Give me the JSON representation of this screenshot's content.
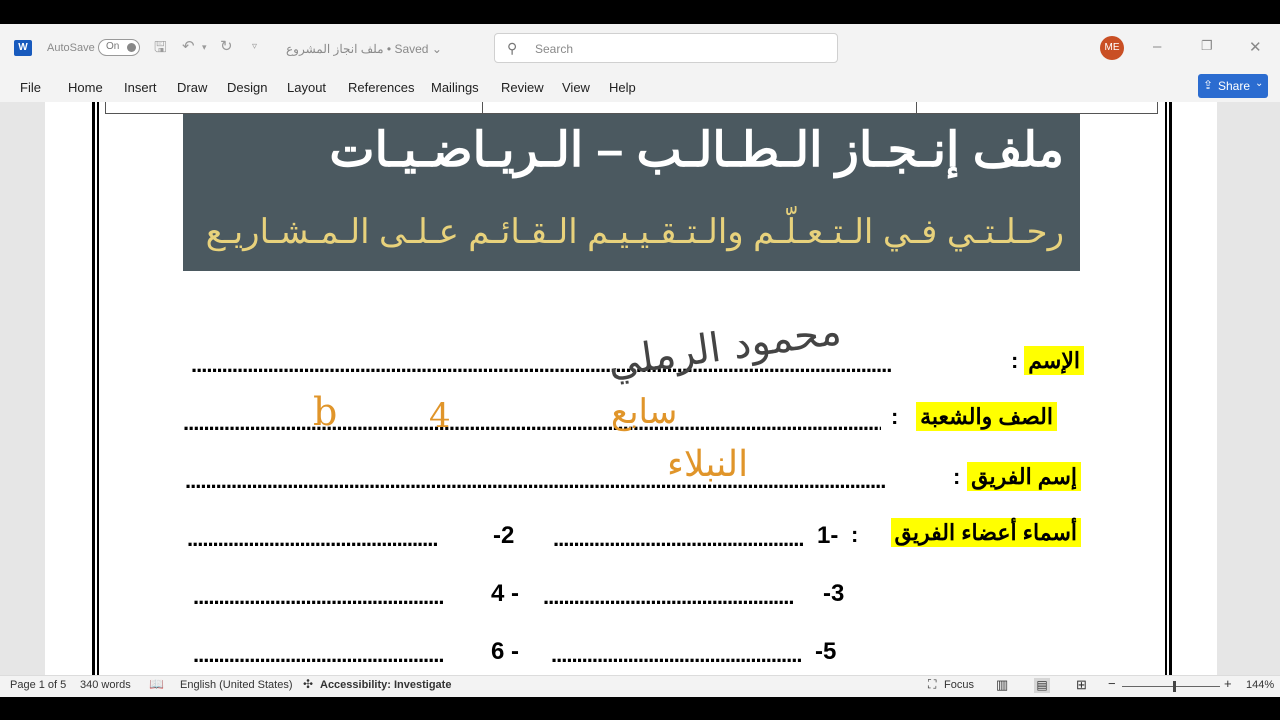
{
  "titlebar": {
    "autosave_label": "AutoSave",
    "autosave_state": "On",
    "doc_title": "ملف انجاز المشروع",
    "saved_status": "• Saved",
    "search_placeholder": "Search",
    "user_initials": "ME"
  },
  "menu": {
    "items": [
      "File",
      "Home",
      "Insert",
      "Draw",
      "Design",
      "Layout",
      "References",
      "Mailings",
      "Review",
      "View",
      "Help"
    ],
    "share_label": "Share"
  },
  "document": {
    "banner_title": "ملف إنـجـاز الـطـالـب – الـريـاضـيـات",
    "banner_subtitle": "رحـلـتـي فـي الـتـعـلّـم والـتـقـيـيـم الـقـائـم عـلـى الـمـشـاريـع",
    "fields": {
      "name_label": "الإسم",
      "class_label": "الصف والشعبة",
      "team_label": "إسم الفريق",
      "members_label": "أسماء أعضاء الفريق",
      "colon": ":"
    },
    "numbers": {
      "n1": "1-",
      "n2": "-2",
      "n3": "-3",
      "n4": "4 -",
      "n5": "-5",
      "n6": "6 -"
    },
    "dots_long": ".........................................................................................................................................",
    "dots_short": ".................................................",
    "handwriting": {
      "name": "محمود الرملي",
      "grade": "سابع",
      "section": "b",
      "team": "النبلاء",
      "four": "4"
    },
    "colors": {
      "banner_bg": "#4b5960",
      "banner_subtitle": "#e8d27c",
      "highlight": "#ffff00",
      "ink": "#e0952a"
    }
  },
  "status": {
    "page": "Page 1 of 5",
    "words": "340 words",
    "language": "English (United States)",
    "accessibility": "Accessibility: Investigate",
    "focus": "Focus",
    "zoom": "144%",
    "minus": "−",
    "plus": "+"
  }
}
